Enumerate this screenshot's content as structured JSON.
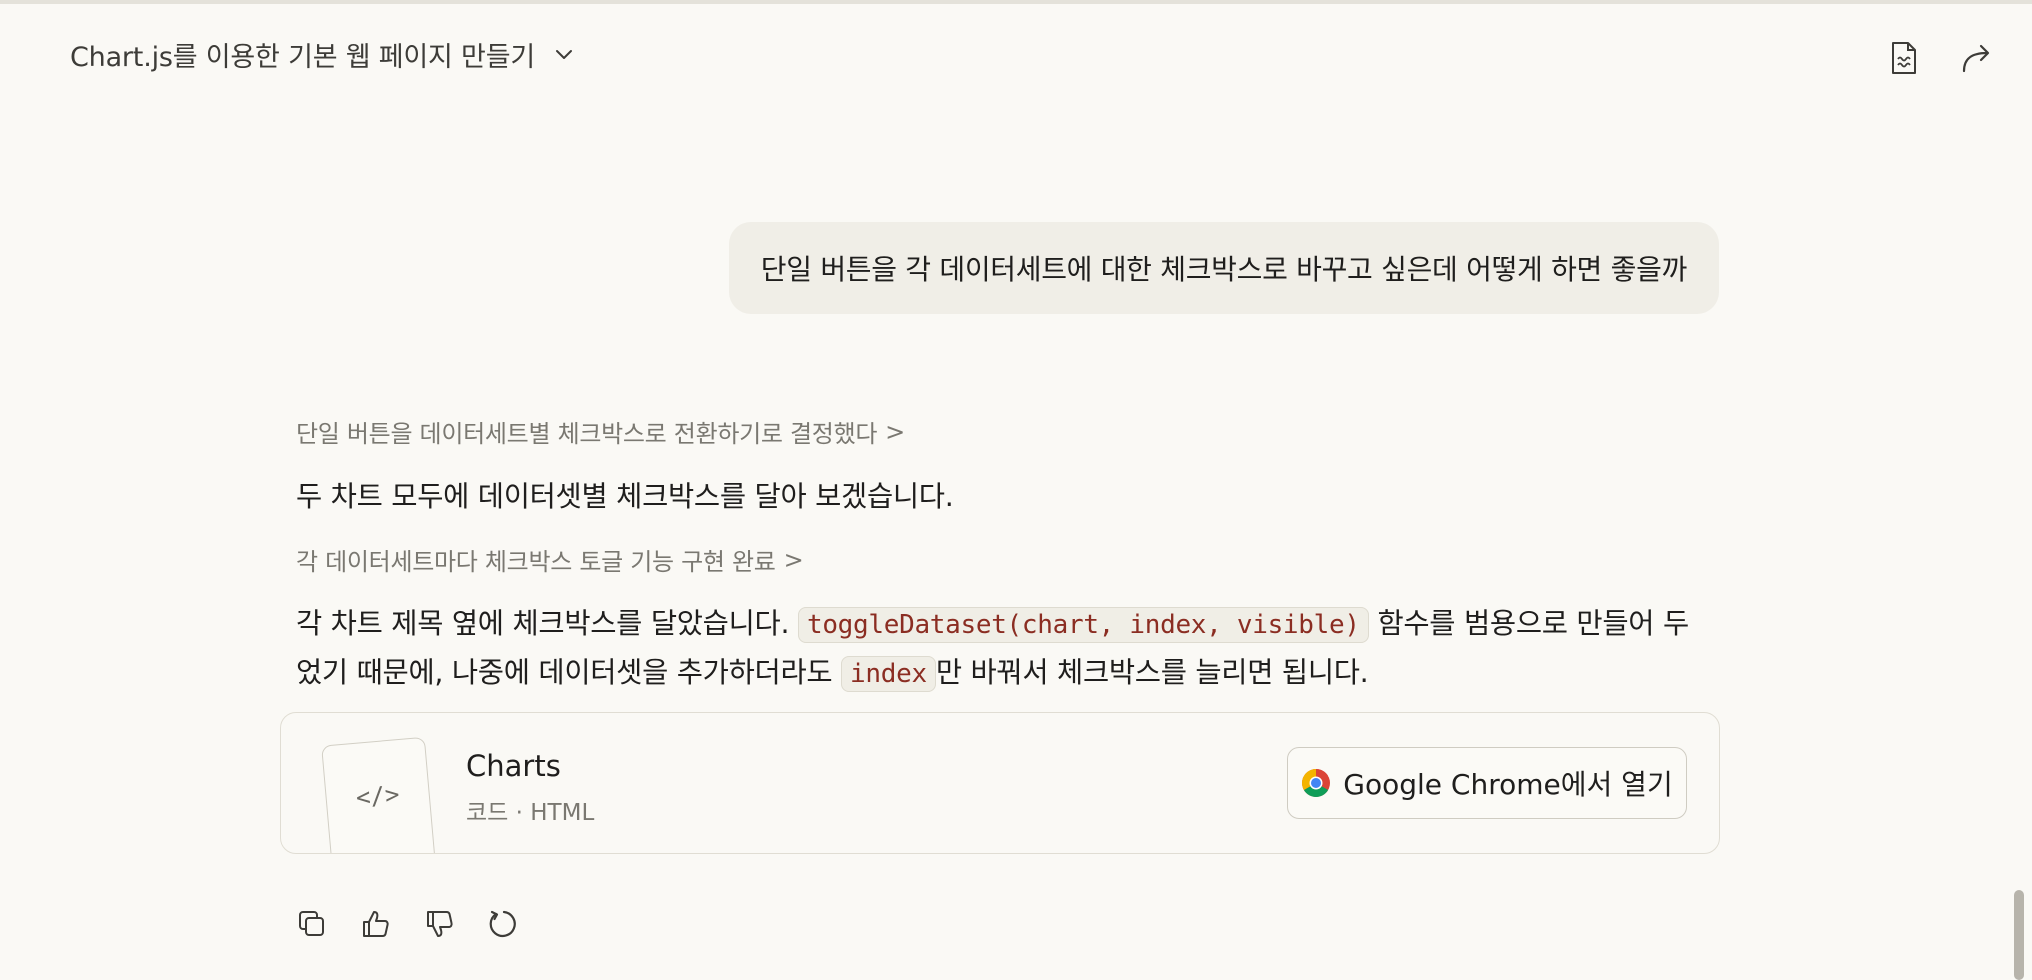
{
  "header": {
    "title": "Chart.js를 이용한 기본 웹 페이지 만들기",
    "title_icon": "chevron-down-icon",
    "right_icons": [
      "document-icon",
      "share-icon"
    ]
  },
  "user_message": "단일 버튼을 각 데이터세트에 대한 체크박스로 바꾸고 싶은데 어떻게 하면 좋을까",
  "assistant": {
    "thinking_1": "단일 버튼을 데이터세트별 체크박스로 전환하기로 결정했다",
    "paragraph_1": "두 차트 모두에 데이터셋별 체크박스를 달아 보겠습니다.",
    "thinking_2": "각 데이터세트마다 체크박스 토글 기능 구현 완료",
    "paragraph_2": {
      "part1": "각 차트 제목 옆에 체크박스를 달았습니다. ",
      "code1": "toggleDataset(chart, index, visible)",
      "part2": " 함수를 범용으로 만들어 두었기 때문에, 나중에 데이터셋을 추가하더라도 ",
      "code2": "index",
      "part3": "만 바꿔서 체크박스를 늘리면 됩니다."
    },
    "thinking_arrow": ">"
  },
  "artifact": {
    "thumb_glyph": "</>",
    "title": "Charts",
    "subtitle": "코드 · HTML",
    "open_label": "Google Chrome에서 열기"
  },
  "actions": [
    "copy-icon",
    "thumbs-up-icon",
    "thumbs-down-icon",
    "retry-icon"
  ]
}
